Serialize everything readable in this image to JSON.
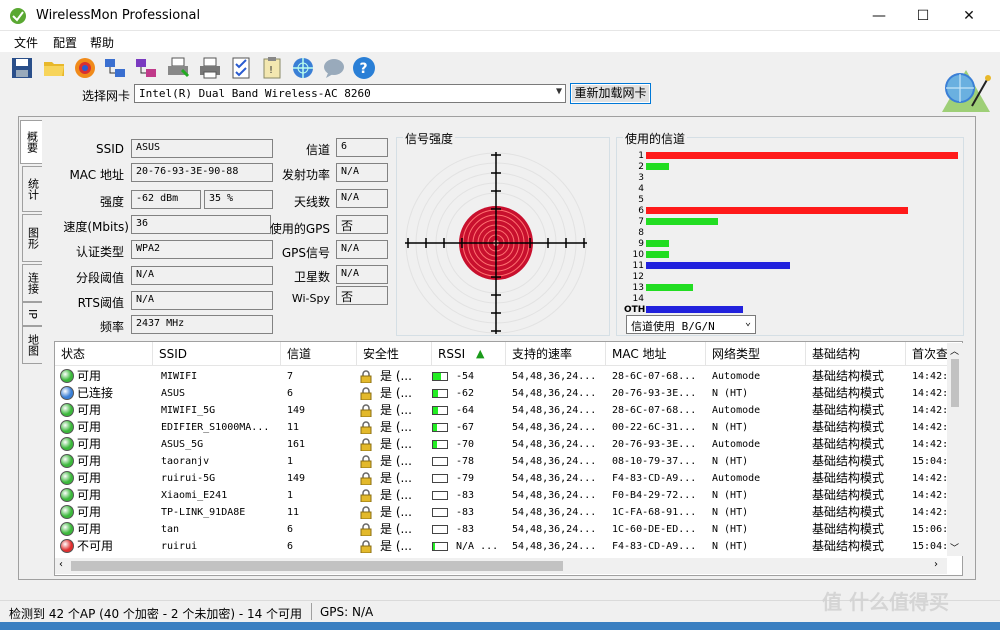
{
  "window": {
    "title": "WirelessMon Professional",
    "minimize": "—",
    "maximize": "☐",
    "close": "✕"
  },
  "menu": [
    "文件",
    "配置",
    "帮助"
  ],
  "toolbar": {
    "icons": [
      "save-icon",
      "open-folder-icon",
      "record-icon",
      "network-icon",
      "network-alt-icon",
      "print-icon",
      "print-alt-icon",
      "checklist-icon",
      "clipboard-icon",
      "globe-icon",
      "chat-icon",
      "help-icon"
    ]
  },
  "adapter": {
    "label": "选择网卡",
    "value": "Intel(R) Dual Band Wireless-AC 8260",
    "reload": "重新加载网卡"
  },
  "tabs": [
    "概要",
    "统计",
    "图形",
    "连接",
    "IP",
    "地图"
  ],
  "info": {
    "ssid_label": "SSID",
    "ssid": "ASUS",
    "mac_label": "MAC 地址",
    "mac": "20-76-93-3E-90-88",
    "strength_label": "强度",
    "strength_dbm": "-62 dBm",
    "strength_pct": "35 %",
    "speed_label": "速度(Mbits)",
    "speed": "36",
    "auth_label": "认证类型",
    "auth": "WPA2",
    "frag_label": "分段阈值",
    "frag": "N/A",
    "rts_label": "RTS阈值",
    "rts": "N/A",
    "freq_label": "频率",
    "freq": "2437 MHz",
    "channel_label": "信道",
    "channel": "6",
    "tx_label": "发射功率",
    "tx": "N/A",
    "antenna_label": "天线数",
    "antenna": "N/A",
    "gps_used_label": "使用的GPS",
    "gps_used": "否",
    "gps_signal_label": "GPS信号",
    "gps_signal": "N/A",
    "sat_label": "卫星数",
    "sat": "N/A",
    "wispy_label": "Wi-Spy",
    "wispy": "否"
  },
  "signal_panel": {
    "title": "信号强度"
  },
  "channel_panel": {
    "title": "使用的信道",
    "select": "信道使用 B/G/N",
    "channels": [
      {
        "label": "1",
        "usage": 1.0,
        "color": "#ff1a1a"
      },
      {
        "label": "2",
        "usage": 0.075,
        "color": "#22dd22"
      },
      {
        "label": "3",
        "usage": 0,
        "color": "#22dd22"
      },
      {
        "label": "4",
        "usage": 0,
        "color": "#22dd22"
      },
      {
        "label": "5",
        "usage": 0,
        "color": "#22dd22"
      },
      {
        "label": "6",
        "usage": 0.84,
        "color": "#ff1a1a"
      },
      {
        "label": "7",
        "usage": 0.23,
        "color": "#22dd22"
      },
      {
        "label": "8",
        "usage": 0,
        "color": "#22dd22"
      },
      {
        "label": "9",
        "usage": 0.075,
        "color": "#22dd22"
      },
      {
        "label": "10",
        "usage": 0.075,
        "color": "#22dd22"
      },
      {
        "label": "11",
        "usage": 0.46,
        "color": "#2222dd"
      },
      {
        "label": "12",
        "usage": 0,
        "color": "#22dd22"
      },
      {
        "label": "13",
        "usage": 0.15,
        "color": "#22dd22"
      },
      {
        "label": "14",
        "usage": 0,
        "color": "#22dd22"
      },
      {
        "label": "OTH",
        "usage": 0.31,
        "color": "#2222dd"
      }
    ]
  },
  "table": {
    "headers": [
      "状态",
      "SSID",
      "信道",
      "安全性",
      "RSSI",
      "支持的速率",
      "MAC 地址",
      "网络类型",
      "基础结构",
      "首次查"
    ],
    "sort_indicator": "▲",
    "rows": [
      {
        "status": "可用",
        "dot": "#3cb83c",
        "ssid": "MIWIFI",
        "channel": "7",
        "security": "是 (...",
        "sig": 0.55,
        "rssi": "-54",
        "rates": "54,48,36,24...",
        "mac": "28-6C-07-68...",
        "type": "Automode",
        "infra": "基础结构模式",
        "first": "14:42:"
      },
      {
        "status": "已连接",
        "dot": "#3a7fd6",
        "ssid": "ASUS",
        "channel": "6",
        "security": "是 (...",
        "sig": 0.35,
        "rssi": "-62",
        "rates": "54,48,36,24...",
        "mac": "20-76-93-3E...",
        "type": "N (HT)",
        "infra": "基础结构模式",
        "first": "14:42:"
      },
      {
        "status": "可用",
        "dot": "#3cb83c",
        "ssid": "MIWIFI_5G",
        "channel": "149",
        "security": "是 (...",
        "sig": 0.35,
        "rssi": "-64",
        "rates": "54,48,36,24...",
        "mac": "28-6C-07-68...",
        "type": "Automode",
        "infra": "基础结构模式",
        "first": "14:42:"
      },
      {
        "status": "可用",
        "dot": "#3cb83c",
        "ssid": "EDIFIER_S1000MA...",
        "channel": "11",
        "security": "是 (...",
        "sig": 0.3,
        "rssi": "-67",
        "rates": "54,48,36,24...",
        "mac": "00-22-6C-31...",
        "type": "N (HT)",
        "infra": "基础结构模式",
        "first": "14:42:"
      },
      {
        "status": "可用",
        "dot": "#3cb83c",
        "ssid": "ASUS_5G",
        "channel": "161",
        "security": "是 (...",
        "sig": 0.25,
        "rssi": "-70",
        "rates": "54,48,36,24...",
        "mac": "20-76-93-3E...",
        "type": "Automode",
        "infra": "基础结构模式",
        "first": "14:42:"
      },
      {
        "status": "可用",
        "dot": "#3cb83c",
        "ssid": "taoranjv",
        "channel": "1",
        "security": "是 (...",
        "sig": 0.0,
        "rssi": "-78",
        "rates": "54,48,36,24...",
        "mac": "08-10-79-37...",
        "type": "N (HT)",
        "infra": "基础结构模式",
        "first": "15:04:"
      },
      {
        "status": "可用",
        "dot": "#3cb83c",
        "ssid": "ruirui-5G",
        "channel": "149",
        "security": "是 (...",
        "sig": 0.0,
        "rssi": "-79",
        "rates": "54,48,36,24...",
        "mac": "F4-83-CD-A9...",
        "type": "Automode",
        "infra": "基础结构模式",
        "first": "14:42:"
      },
      {
        "status": "可用",
        "dot": "#3cb83c",
        "ssid": "Xiaomi_E241",
        "channel": "1",
        "security": "是 (...",
        "sig": 0.0,
        "rssi": "-83",
        "rates": "54,48,36,24...",
        "mac": "F0-B4-29-72...",
        "type": "N (HT)",
        "infra": "基础结构模式",
        "first": "14:42:"
      },
      {
        "status": "可用",
        "dot": "#3cb83c",
        "ssid": "TP-LINK_91DA8E",
        "channel": "11",
        "security": "是 (...",
        "sig": 0.0,
        "rssi": "-83",
        "rates": "54,48,36,24...",
        "mac": "1C-FA-68-91...",
        "type": "N (HT)",
        "infra": "基础结构模式",
        "first": "14:42:"
      },
      {
        "status": "可用",
        "dot": "#3cb83c",
        "ssid": "tan",
        "channel": "6",
        "security": "是 (...",
        "sig": 0.0,
        "rssi": "-83",
        "rates": "54,48,36,24...",
        "mac": "1C-60-DE-ED...",
        "type": "N (HT)",
        "infra": "基础结构模式",
        "first": "15:06:"
      },
      {
        "status": "不可用",
        "dot": "#e03030",
        "ssid": "ruirui",
        "channel": "6",
        "security": "是 (...",
        "sig": 0.12,
        "rssi": "N/A ...",
        "rates": "54,48,36,24...",
        "mac": "F4-83-CD-A9...",
        "type": "N (HT)",
        "infra": "基础结构模式",
        "first": "15:04:"
      }
    ]
  },
  "status": {
    "text": "检测到 42 个AP (40 个加密 - 2 个未加密) - 14 个可用",
    "gps": "GPS: N/A"
  },
  "watermark": "值 什么值得买"
}
